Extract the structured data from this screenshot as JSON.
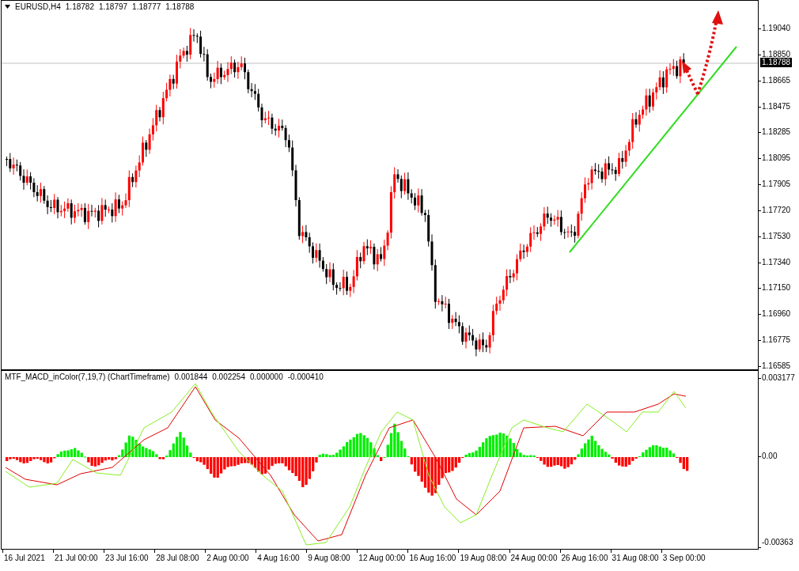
{
  "main_chart": {
    "symbol": "EURUSD,H4",
    "quotes": [
      "1.18782",
      "1.18797",
      "1.18777",
      "1.18788"
    ],
    "price_axis": [
      "1.19040",
      "1.18850",
      "1.18665",
      "1.18475",
      "1.18285",
      "1.18095",
      "1.17905",
      "1.17720",
      "1.17530",
      "1.17340",
      "1.17150",
      "1.16960",
      "1.16775",
      "1.16585"
    ],
    "current_price": "1.18788"
  },
  "indicator": {
    "name": "MTF_MACD_inColor(7,19,7) (ChartTimeframe)",
    "values": [
      "0.001844",
      "0.002254",
      "0.000000",
      "-0.000410"
    ],
    "axis": [
      "0.003177",
      "0.00",
      "-0.00363"
    ]
  },
  "time_axis": [
    "16 Jul 2021",
    "21 Jul 00:00",
    "23 Jul 16:00",
    "28 Jul 08:00",
    "2 Aug 00:00",
    "4 Aug 16:00",
    "9 Aug 08:00",
    "12 Aug 00:00",
    "16 Aug 16:00",
    "19 Aug 08:00",
    "24 Aug 00:00",
    "26 Aug 16:00",
    "31 Aug 08:00",
    "3 Sep 00:00"
  ]
}
